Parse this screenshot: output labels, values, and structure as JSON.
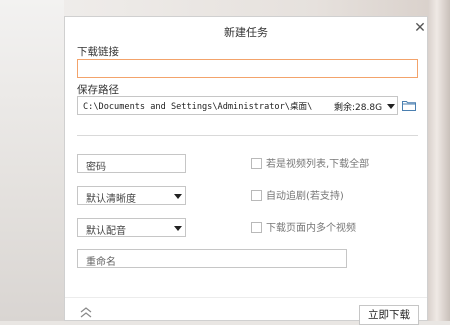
{
  "dialog": {
    "title": "新建任务",
    "close_glyph": "✕"
  },
  "download_link": {
    "label": "下载链接",
    "value": ""
  },
  "save_path": {
    "label": "保存路径",
    "value": "C:\\Documents and Settings\\Administrator\\桌面\\",
    "free_space": "剩余:28.8G"
  },
  "password": {
    "placeholder": "密码"
  },
  "quality": {
    "selected": "默认清晰度"
  },
  "audio": {
    "selected": "默认配音"
  },
  "rename": {
    "placeholder": "重命名"
  },
  "options": [
    {
      "label": "若是视频列表,下载全部",
      "checked": false
    },
    {
      "label": "自动追剧(若支持)",
      "checked": false
    },
    {
      "label": "下载页面内多个视频",
      "checked": false
    }
  ],
  "actions": {
    "download_now": "立即下载"
  },
  "icons": {
    "close": "close-icon",
    "folder": "folder-icon",
    "expand": "double-chevron-up-icon",
    "dropdown": "chevron-down-icon"
  },
  "colors": {
    "focus_border": "#f3a36b",
    "border": "#c6c6c6",
    "divider": "#d9d9d9"
  }
}
